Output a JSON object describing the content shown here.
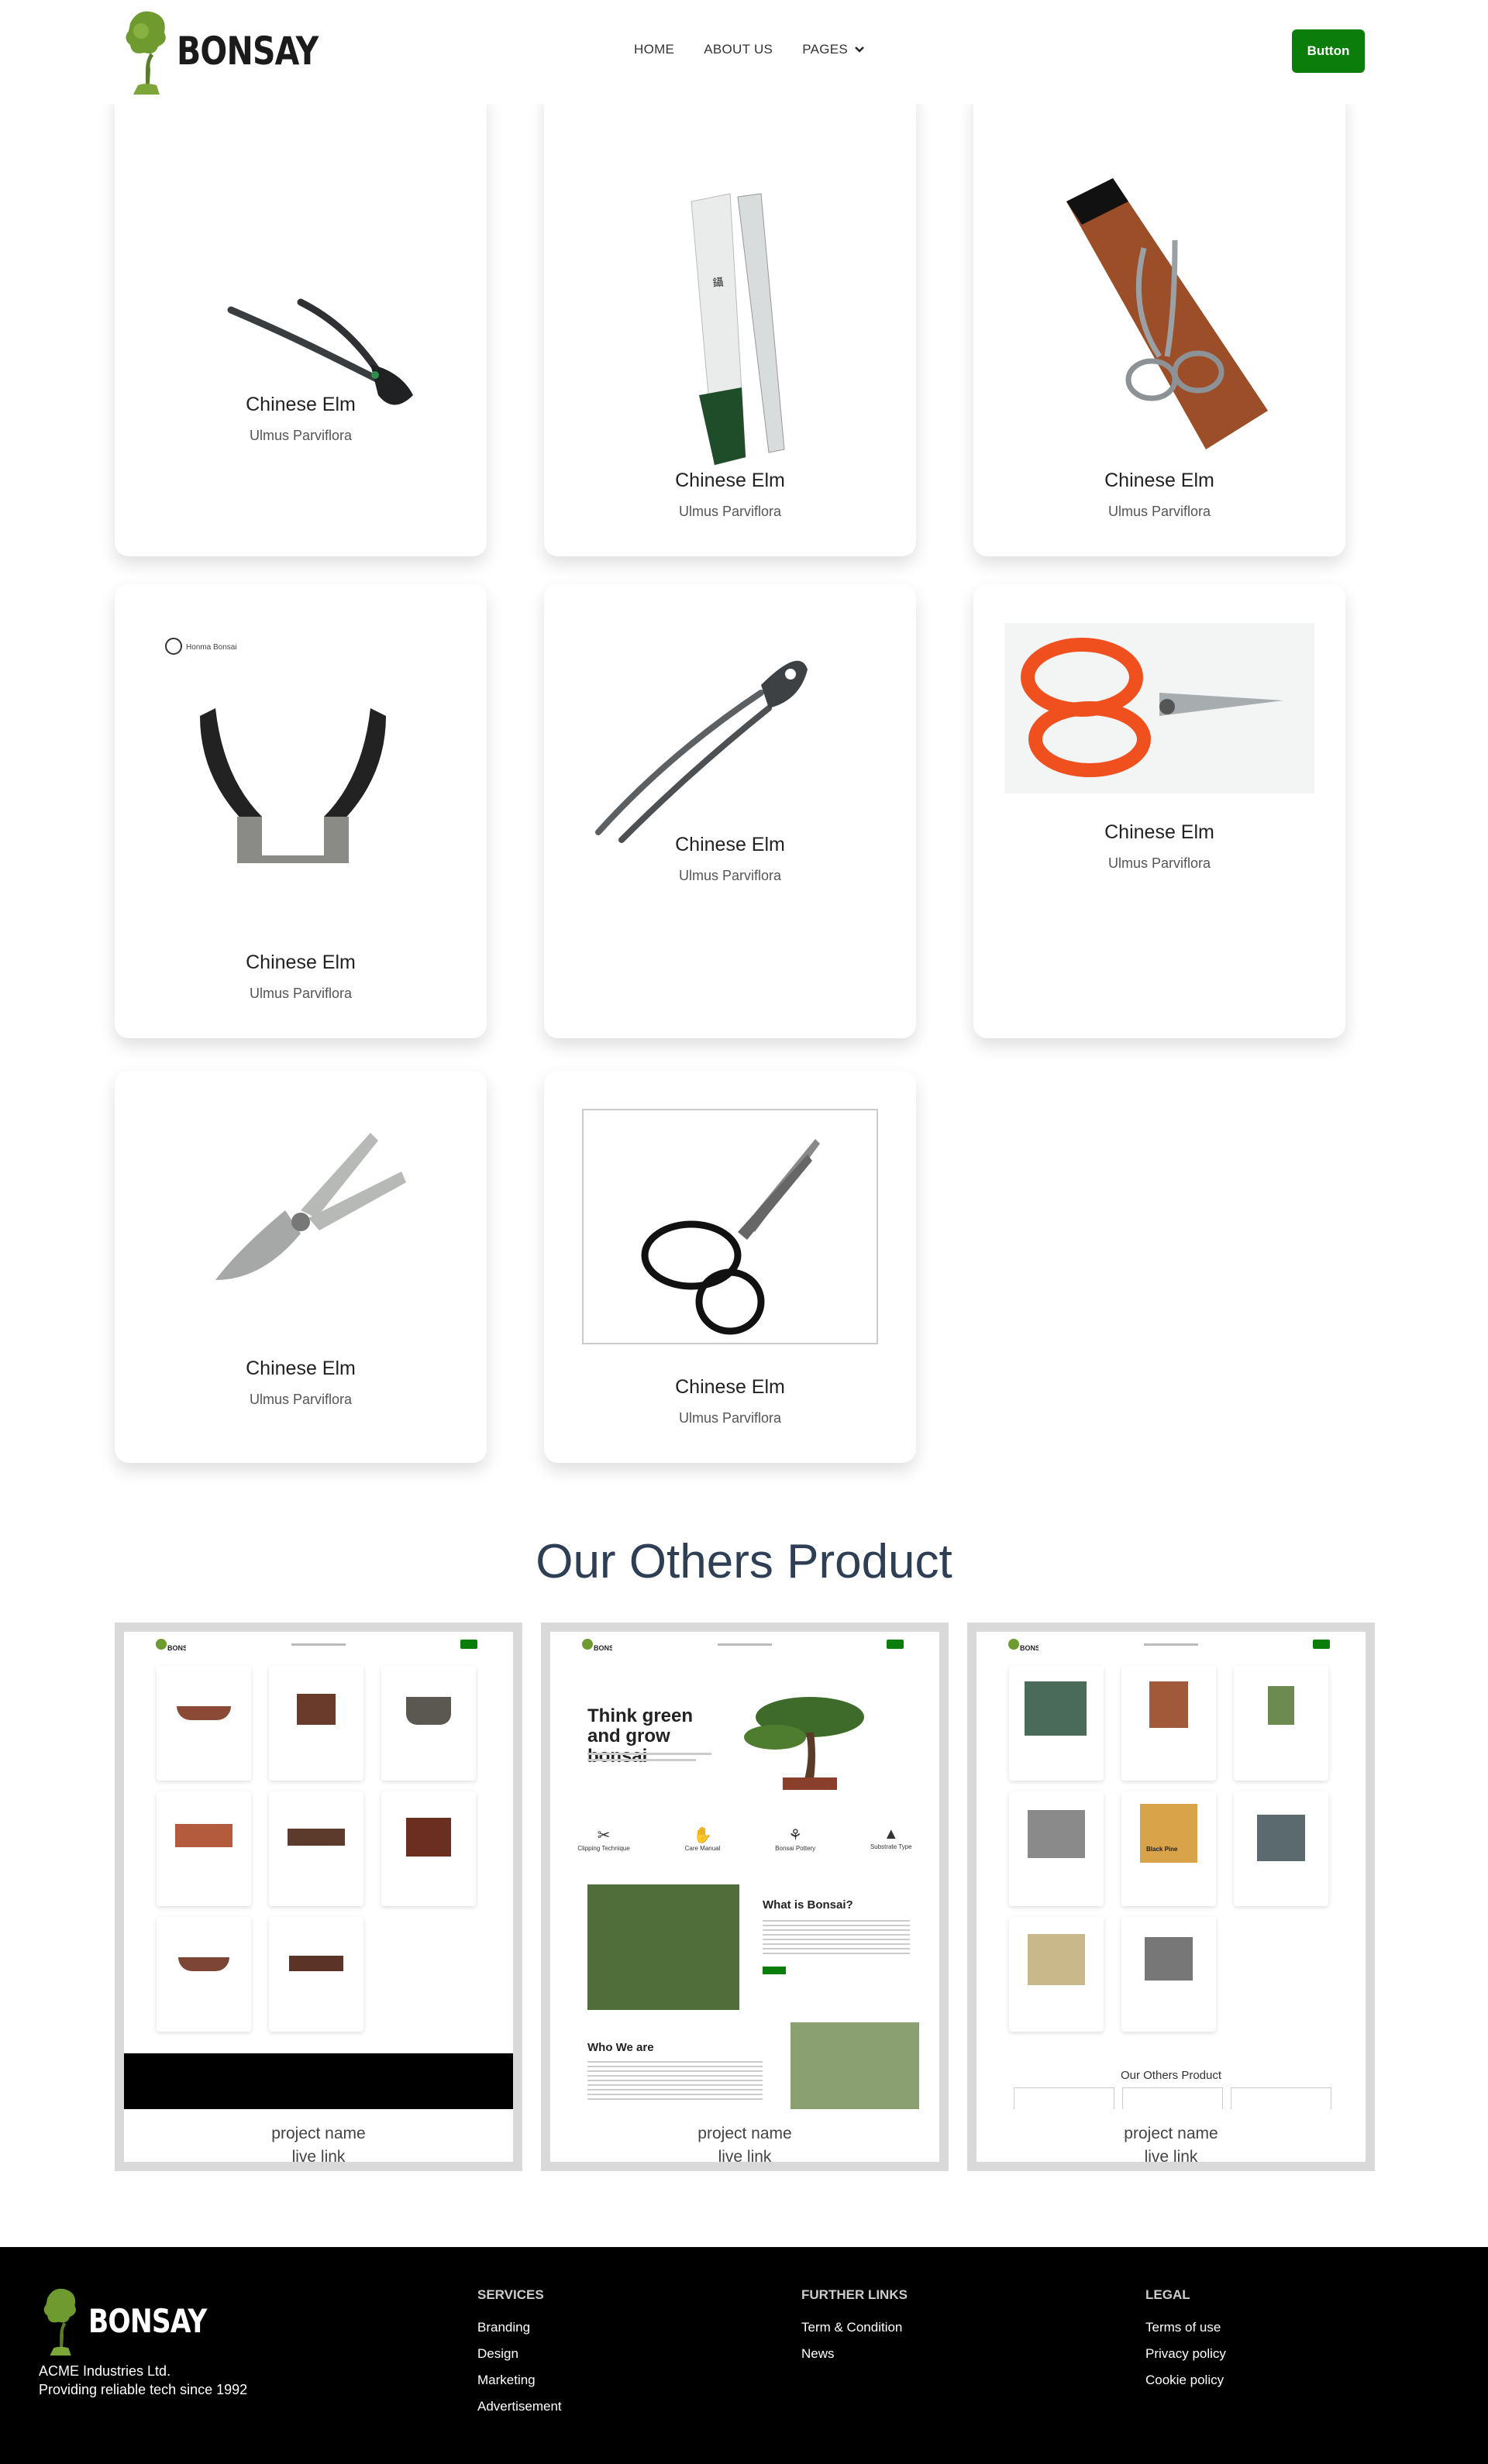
{
  "brand": {
    "name": "BONSAY"
  },
  "nav": {
    "items": [
      "HOME",
      "ABOUT US",
      "PAGES"
    ],
    "button_label": "Button"
  },
  "products": [
    {
      "title": "Chinese Elm",
      "subtitle": "Ulmus Parviflora",
      "icon": "concave-cutter-icon"
    },
    {
      "title": "Chinese Elm",
      "subtitle": "Ulmus Parviflora",
      "icon": "tweezers-package-icon"
    },
    {
      "title": "Chinese Elm",
      "subtitle": "Ulmus Parviflora",
      "icon": "scissors-package-icon"
    },
    {
      "title": "Chinese Elm",
      "subtitle": "Ulmus Parviflora",
      "icon": "knob-cutter-icon"
    },
    {
      "title": "Chinese Elm",
      "subtitle": "Ulmus Parviflora",
      "icon": "long-cutter-icon"
    },
    {
      "title": "Chinese Elm",
      "subtitle": "Ulmus Parviflora",
      "icon": "orange-scissors-icon"
    },
    {
      "title": "Chinese Elm",
      "subtitle": "Ulmus Parviflora",
      "icon": "pruning-shears-icon"
    },
    {
      "title": "Chinese Elm",
      "subtitle": "Ulmus Parviflora",
      "icon": "bonsai-scissors-icon"
    }
  ],
  "others": {
    "title": "Our Others Product",
    "projects": [
      {
        "name": "project name",
        "link": "live link"
      },
      {
        "name": "project name",
        "link": "live link"
      },
      {
        "name": "project name",
        "link": "live link"
      }
    ],
    "preview2": {
      "hero": "Think green and grow bonsai",
      "features": [
        "Clipping Technique",
        "Care Manual",
        "Bonsai Pottery",
        "Substrate Type"
      ],
      "what": "What is Bonsai?",
      "who": "Who We are"
    },
    "preview3": {
      "footer_title": "Our Others Product",
      "badge": "Black Pine"
    }
  },
  "footer": {
    "company": "ACME Industries Ltd.",
    "tagline": "Providing reliable tech since 1992",
    "services": {
      "heading": "SERVICES",
      "items": [
        "Branding",
        "Design",
        "Marketing",
        "Advertisement"
      ]
    },
    "further": {
      "heading": "FURTHER LINKS",
      "items": [
        "Term & Condition",
        "News"
      ]
    },
    "legal": {
      "heading": "LEGAL",
      "items": [
        "Terms of use",
        "Privacy policy",
        "Cookie policy"
      ]
    }
  },
  "colors": {
    "accent": "#0a7d0a",
    "title": "#2d3e55",
    "footer_bg": "#000000"
  }
}
